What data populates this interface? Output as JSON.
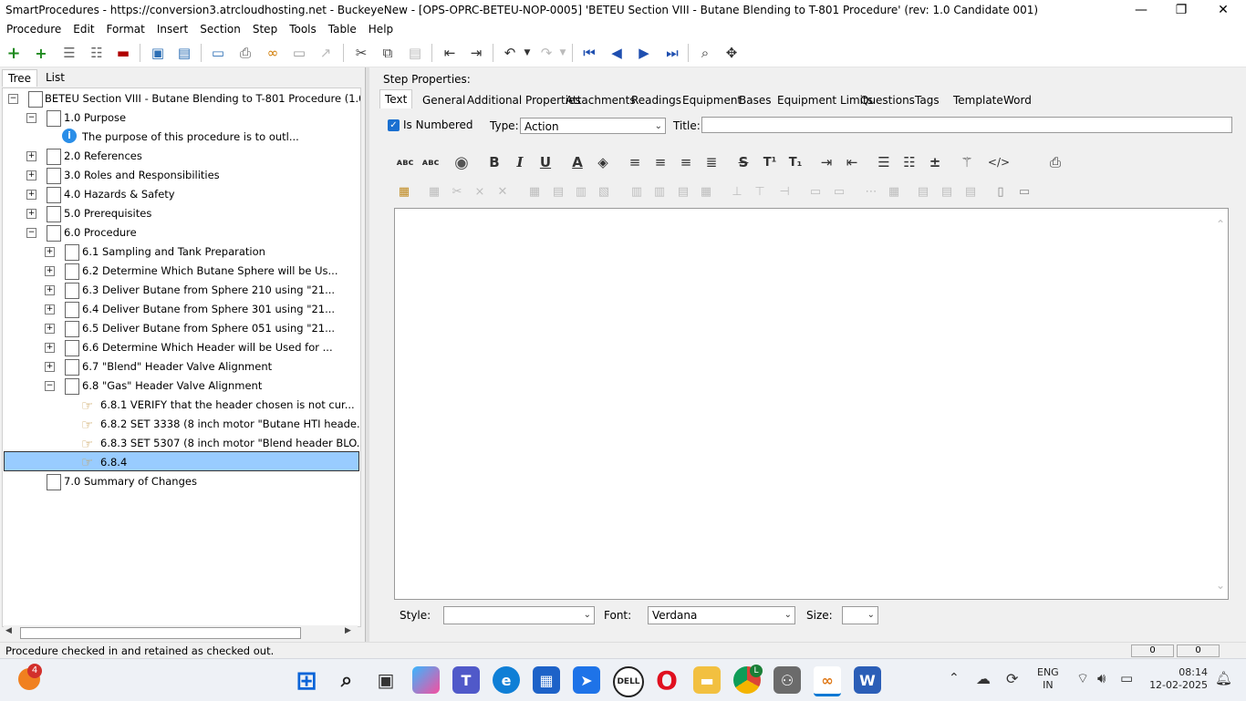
{
  "window": {
    "title": "SmartProcedures - https://conversion3.atrcloudhosting.net - BuckeyeNew - [OPS-OPRC-BETEU-NOP-0005] 'BETEU Section VIII - Butane Blending to T-801 Procedure' (rev: 1.0 Candidate 001)",
    "minimize": "—",
    "restore": "❐",
    "close": "✕"
  },
  "menu": [
    "Procedure",
    "Edit",
    "Format",
    "Insert",
    "Section",
    "Step",
    "Tools",
    "Table",
    "Help"
  ],
  "left_tabs": {
    "tree": "Tree",
    "list": "List"
  },
  "tree": {
    "root": "BETEU Section VIII - Butane Blending to T-801 Procedure (1.0 Ca...",
    "nodes": {
      "n1": "1.0 Purpose",
      "n1a": "The purpose of this procedure is to outl...",
      "n2": "2.0 References",
      "n3": "3.0 Roles and Responsibilities",
      "n4": "4.0 Hazards & Safety",
      "n5": "5.0 Prerequisites",
      "n6": "6.0 Procedure",
      "n61": "6.1 Sampling and Tank Preparation",
      "n62": "6.2 Determine Which Butane Sphere will be Us...",
      "n63": "6.3 Deliver Butane from Sphere 210 using \"21...",
      "n64": "6.4 Deliver Butane from Sphere 301 using \"21...",
      "n65": "6.5 Deliver Butane from Sphere 051 using \"21...",
      "n66": "6.6 Determine Which Header will be Used for ...",
      "n67": "6.7 \"Blend\" Header Valve Alignment",
      "n68": "6.8 \"Gas\" Header Valve Alignment",
      "n681": "6.8.1 VERIFY that the header chosen is not cur...",
      "n682": "6.8.2 SET 3338 (8 inch motor \"Butane HTI heade...",
      "n683": "6.8.3 SET 5307 (8 inch motor \"Blend header BLO...",
      "n684": "6.8.4",
      "n7": "7.0 Summary of Changes"
    }
  },
  "step": {
    "heading": "Step Properties:",
    "tabs": [
      "Text",
      "General",
      "Additional Properties",
      "Attachments",
      "Readings",
      "Equipment",
      "Bases",
      "Equipment Limits",
      "Questions",
      "Tags",
      "Template",
      "Word"
    ],
    "is_numbered_label": "Is Numbered",
    "is_numbered": true,
    "type_label": "Type:",
    "type_value": "Action",
    "title_label": "Title:",
    "title_value": "",
    "style_label": "Style:",
    "style_value": "",
    "font_label": "Font:",
    "font_value": "Verdana",
    "size_label": "Size:",
    "size_value": ""
  },
  "format_icons": {
    "bold": "B",
    "italic": "I",
    "underline": "U",
    "font_color": "A",
    "strike": "S",
    "superscript": "T¹",
    "subscript": "T₁",
    "source": "</>"
  },
  "status": {
    "message": "Procedure checked in and retained as checked out.",
    "cell1": "0",
    "cell2": "0"
  },
  "taskbar": {
    "notification_badge": "4",
    "chrome_badge": "L",
    "lang_line1": "ENG",
    "lang_line2": "IN",
    "time": "08:14",
    "date": "12-02-2025"
  },
  "colors": {
    "selection": "#99ccff",
    "accent": "#0078d4"
  }
}
